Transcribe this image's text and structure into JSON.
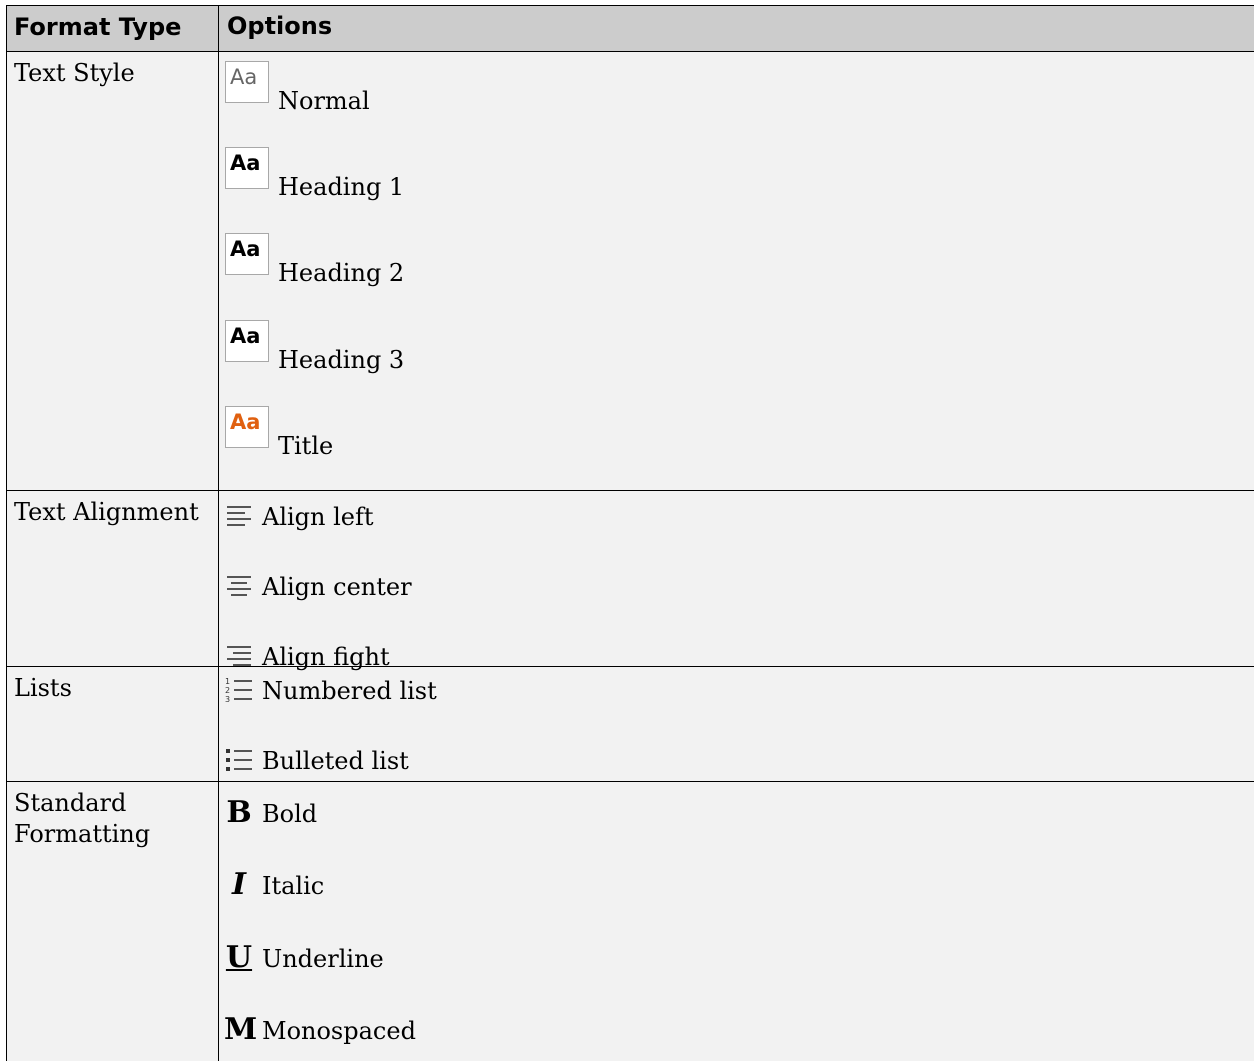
{
  "table": {
    "headers": {
      "format_type": "Format Type",
      "options": "Options"
    },
    "rows": [
      {
        "format_type": "Text Style",
        "options": [
          {
            "icon": "text-style-normal-icon",
            "icon_text": "Aa",
            "label": "Normal"
          },
          {
            "icon": "text-style-heading1-icon",
            "icon_text": "Aa",
            "label": "Heading 1"
          },
          {
            "icon": "text-style-heading2-icon",
            "icon_text": "Aa",
            "label": "Heading 2"
          },
          {
            "icon": "text-style-heading3-icon",
            "icon_text": "Aa",
            "label": "Heading 3"
          },
          {
            "icon": "text-style-title-icon",
            "icon_text": "Aa",
            "label": "Title"
          }
        ]
      },
      {
        "format_type": "Text Alignment",
        "options": [
          {
            "icon": "align-left-icon",
            "label": "Align left"
          },
          {
            "icon": "align-center-icon",
            "label": "Align center"
          },
          {
            "icon": "align-right-icon",
            "label": "Align fight"
          }
        ]
      },
      {
        "format_type": "Lists",
        "options": [
          {
            "icon": "numbered-list-icon",
            "label": "Numbered list"
          },
          {
            "icon": "bulleted-list-icon",
            "label": "Bulleted list"
          }
        ]
      },
      {
        "format_type": "Standard Formatting",
        "format_type_lines": [
          "Standard",
          "Formatting"
        ],
        "options": [
          {
            "icon": "bold-icon",
            "icon_text": "B",
            "label": "Bold"
          },
          {
            "icon": "italic-icon",
            "icon_text": "I",
            "label": "Italic"
          },
          {
            "icon": "underline-icon",
            "icon_text": "U",
            "label": "Underline"
          },
          {
            "icon": "monospaced-icon",
            "icon_text": "M",
            "label": "Monospaced"
          }
        ]
      }
    ]
  },
  "colors": {
    "header_bg": "#cccccc",
    "cell_bg": "#f2f2f2",
    "title_icon": "#e06010",
    "normal_icon": "#666666"
  }
}
